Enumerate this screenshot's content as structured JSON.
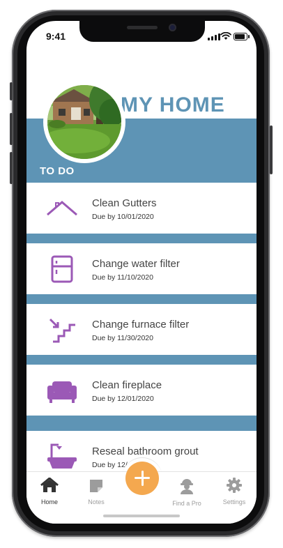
{
  "status_bar": {
    "time": "9:41"
  },
  "header": {
    "title": "MY HOME",
    "section": "TO DO",
    "photo_icon": "house-photo"
  },
  "tasks": [
    {
      "title": "Clean Gutters",
      "due": "Due by 10/01/2020",
      "icon": "roof-icon"
    },
    {
      "title": "Change water filter",
      "due": "Due by 11/10/2020",
      "icon": "fridge-icon"
    },
    {
      "title": "Change furnace filter",
      "due": "Due by 11/30/2020",
      "icon": "stairs-icon"
    },
    {
      "title": "Clean fireplace",
      "due": "Due by 12/01/2020",
      "icon": "sofa-icon"
    },
    {
      "title": "Reseal bathroom grout",
      "due": "Due by 12/",
      "icon": "bathtub-icon"
    }
  ],
  "tab_bar": {
    "home": "Home",
    "notes": "Notes",
    "find_pro": "Find a Pro",
    "settings": "Settings",
    "add_icon": "plus-icon"
  },
  "colors": {
    "accent_blue": "#5e94b5",
    "icon_purple": "#9b59b6",
    "fab_orange": "#f4a84f"
  }
}
